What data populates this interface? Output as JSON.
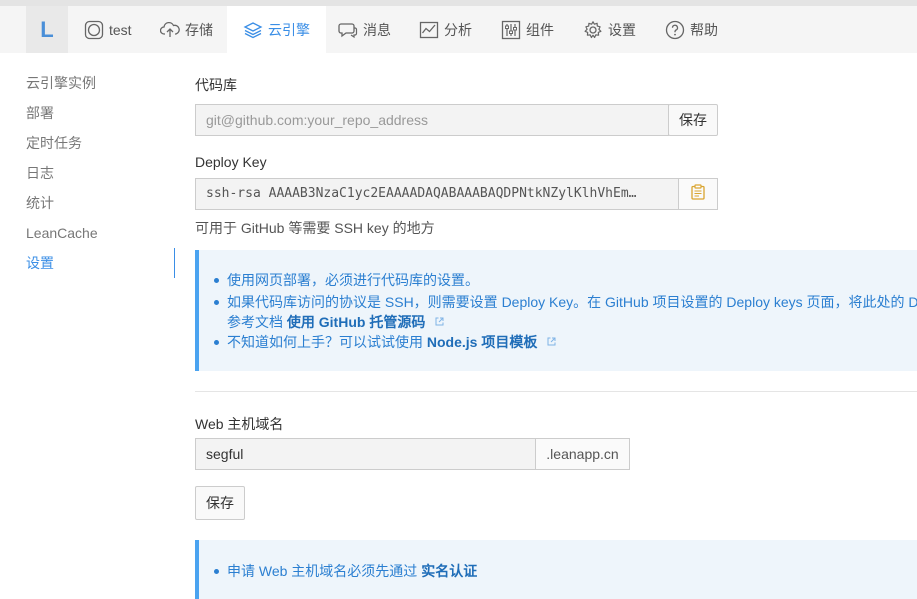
{
  "nav": {
    "logo": "L",
    "items": [
      {
        "label": "test",
        "icon": "circle-icon"
      },
      {
        "label": "存储",
        "icon": "cloud-upload-icon"
      },
      {
        "label": "云引擎",
        "icon": "layers-icon"
      },
      {
        "label": "消息",
        "icon": "chat-icon"
      },
      {
        "label": "分析",
        "icon": "chart-icon"
      },
      {
        "label": "组件",
        "icon": "sliders-icon"
      },
      {
        "label": "设置",
        "icon": "gear-icon"
      },
      {
        "label": "帮助",
        "icon": "question-icon"
      }
    ],
    "active": "云引擎"
  },
  "sidebar": {
    "items": [
      {
        "label": "云引擎实例"
      },
      {
        "label": "部署"
      },
      {
        "label": "定时任务"
      },
      {
        "label": "日志"
      },
      {
        "label": "统计"
      },
      {
        "label": "LeanCache"
      },
      {
        "label": "设置"
      }
    ],
    "active": "设置"
  },
  "repo": {
    "label": "代码库",
    "placeholder": "git@github.com:your_repo_address",
    "save_label": "保存"
  },
  "deploy_key": {
    "label": "Deploy Key",
    "value": "ssh-rsa AAAAB3NzaC1yc2EAAAADAQABAAABAQDPNtkNZylKlhVhEm…",
    "help": "可用于 GitHub 等需要 SSH key 的地方"
  },
  "info1": {
    "item1": "使用网页部署，必须进行代码库的设置。",
    "item2": "如果代码库访问的协议是 SSH，则需要设置 Deploy Key。在 GitHub 项目设置的 Deploy keys 页面，将此处的 D",
    "item2_cont_prefix": "参考文档",
    "item2_link": "使用 GitHub 托管源码",
    "item3_prefix": "不知道如何上手？可以试试使用",
    "item3_link": "Node.js 项目模板"
  },
  "web_domain": {
    "label": "Web 主机域名",
    "value": "segful",
    "suffix": ".leanapp.cn",
    "save_label": "保存"
  },
  "info2": {
    "item1_prefix": "申请 Web 主机域名必须先通过",
    "item1_link": "实名认证"
  },
  "colors": {
    "accent": "#3a8ee6",
    "info_bg": "#eef5fb",
    "info_border": "#4aa3f0",
    "info_text": "#2b7fd1"
  }
}
